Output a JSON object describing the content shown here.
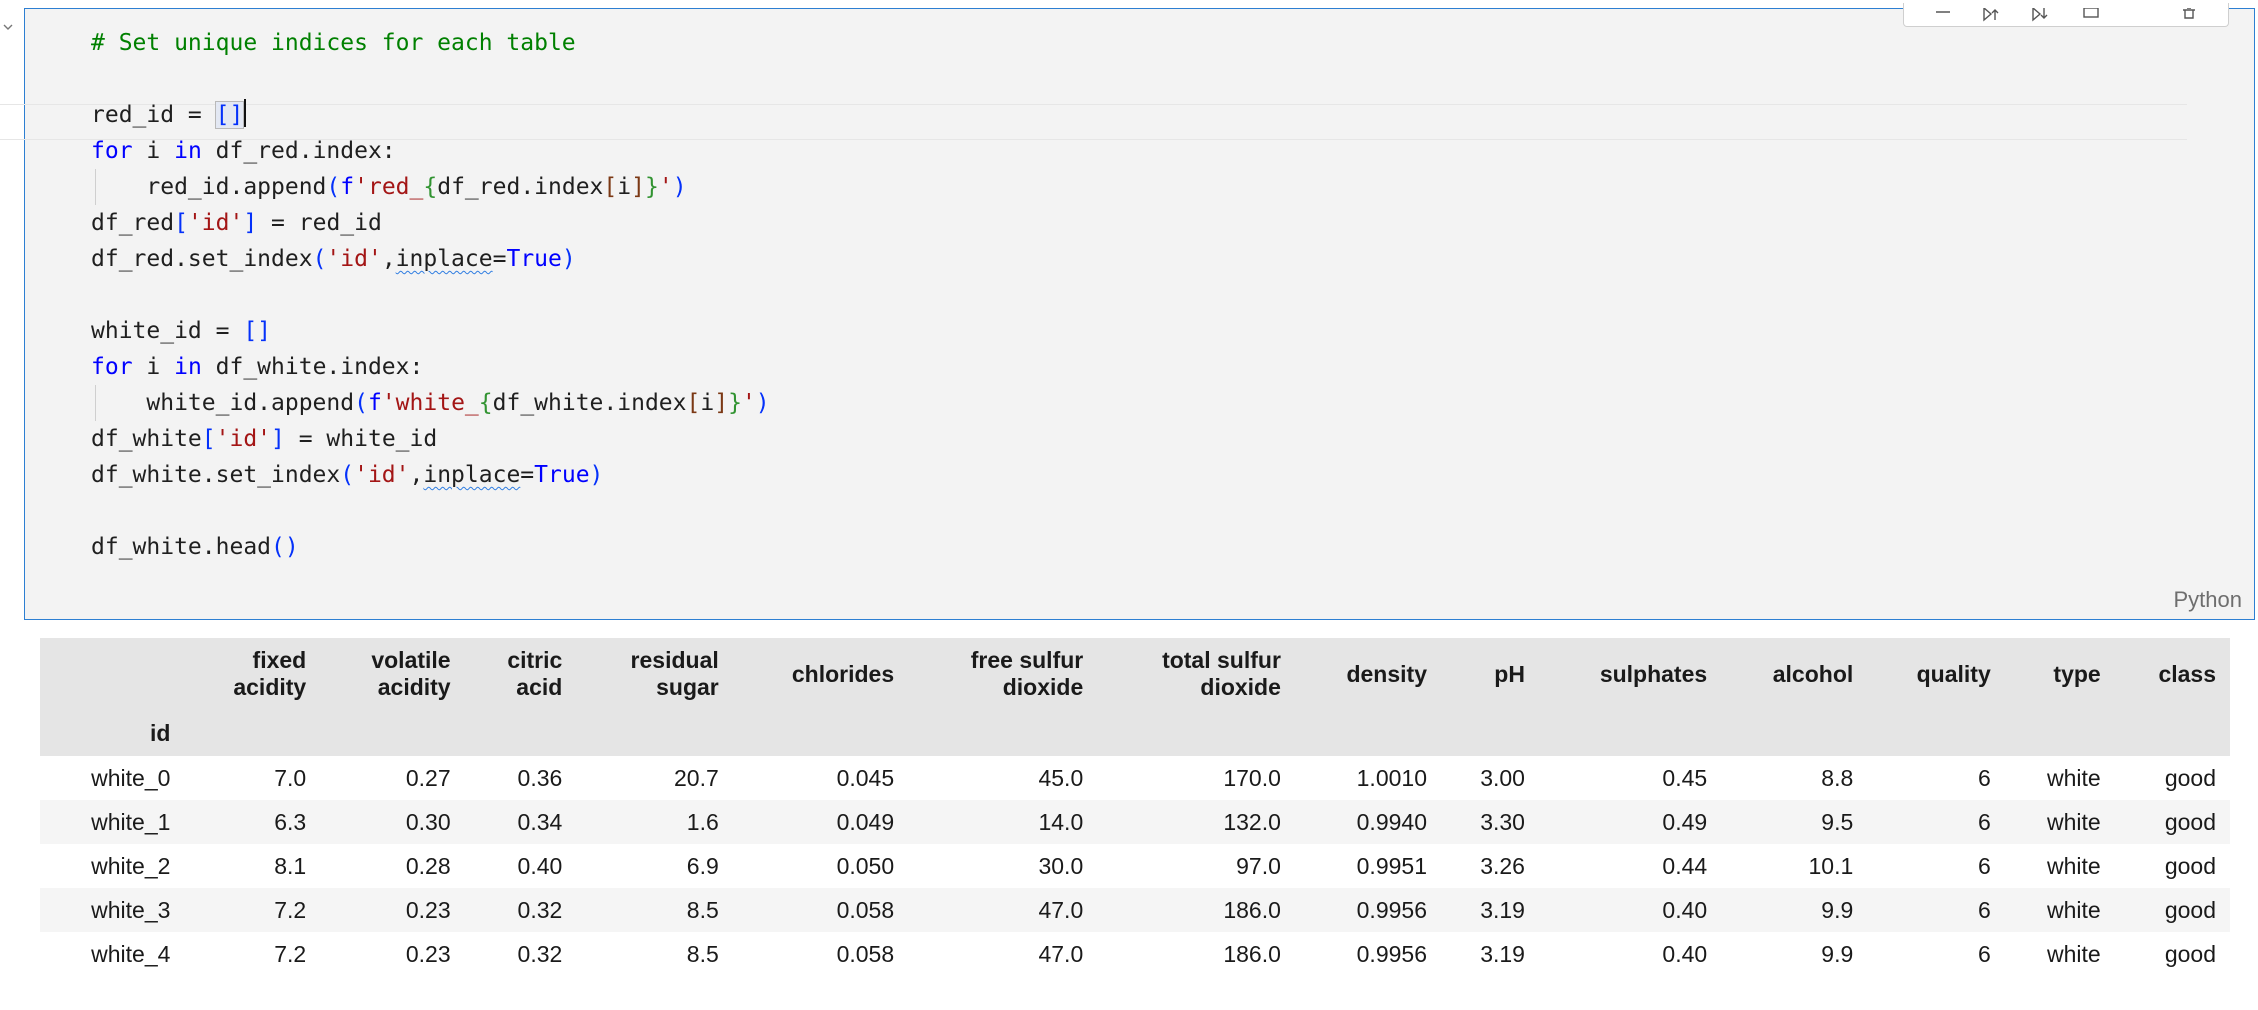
{
  "cell": {
    "language": "Python",
    "code_lines": [
      "# Set unique indices for each table",
      "",
      "red_id = []",
      "for i in df_red.index:",
      "    red_id.append(f'red_{df_red.index[i]}')",
      "df_red['id'] = red_id",
      "df_red.set_index('id',inplace=True)",
      "",
      "white_id = []",
      "for i in df_white.index:",
      "    white_id.append(f'white_{df_white.index[i]}')",
      "df_white['id'] = white_id",
      "df_white.set_index('id',inplace=True)",
      "",
      "df_white.head()"
    ]
  },
  "table": {
    "index_name": "id",
    "columns": [
      [
        "fixed",
        "acidity"
      ],
      [
        "volatile",
        "acidity"
      ],
      [
        "citric",
        "acid"
      ],
      [
        "residual",
        "sugar"
      ],
      [
        "chlorides"
      ],
      [
        "free sulfur",
        "dioxide"
      ],
      [
        "total sulfur",
        "dioxide"
      ],
      [
        "density"
      ],
      [
        "pH"
      ],
      [
        "sulphates"
      ],
      [
        "alcohol"
      ],
      [
        "quality"
      ],
      [
        "type"
      ],
      [
        "class"
      ]
    ],
    "rows": [
      {
        "id": "white_0",
        "values": [
          "7.0",
          "0.27",
          "0.36",
          "20.7",
          "0.045",
          "45.0",
          "170.0",
          "1.0010",
          "3.00",
          "0.45",
          "8.8",
          "6",
          "white",
          "good"
        ]
      },
      {
        "id": "white_1",
        "values": [
          "6.3",
          "0.30",
          "0.34",
          "1.6",
          "0.049",
          "14.0",
          "132.0",
          "0.9940",
          "3.30",
          "0.49",
          "9.5",
          "6",
          "white",
          "good"
        ]
      },
      {
        "id": "white_2",
        "values": [
          "8.1",
          "0.28",
          "0.40",
          "6.9",
          "0.050",
          "30.0",
          "97.0",
          "0.9951",
          "3.26",
          "0.44",
          "10.1",
          "6",
          "white",
          "good"
        ]
      },
      {
        "id": "white_3",
        "values": [
          "7.2",
          "0.23",
          "0.32",
          "8.5",
          "0.058",
          "47.0",
          "186.0",
          "0.9956",
          "3.19",
          "0.40",
          "9.9",
          "6",
          "white",
          "good"
        ]
      },
      {
        "id": "white_4",
        "values": [
          "7.2",
          "0.23",
          "0.32",
          "8.5",
          "0.058",
          "47.0",
          "186.0",
          "0.9956",
          "3.19",
          "0.40",
          "9.9",
          "6",
          "white",
          "good"
        ]
      }
    ]
  }
}
